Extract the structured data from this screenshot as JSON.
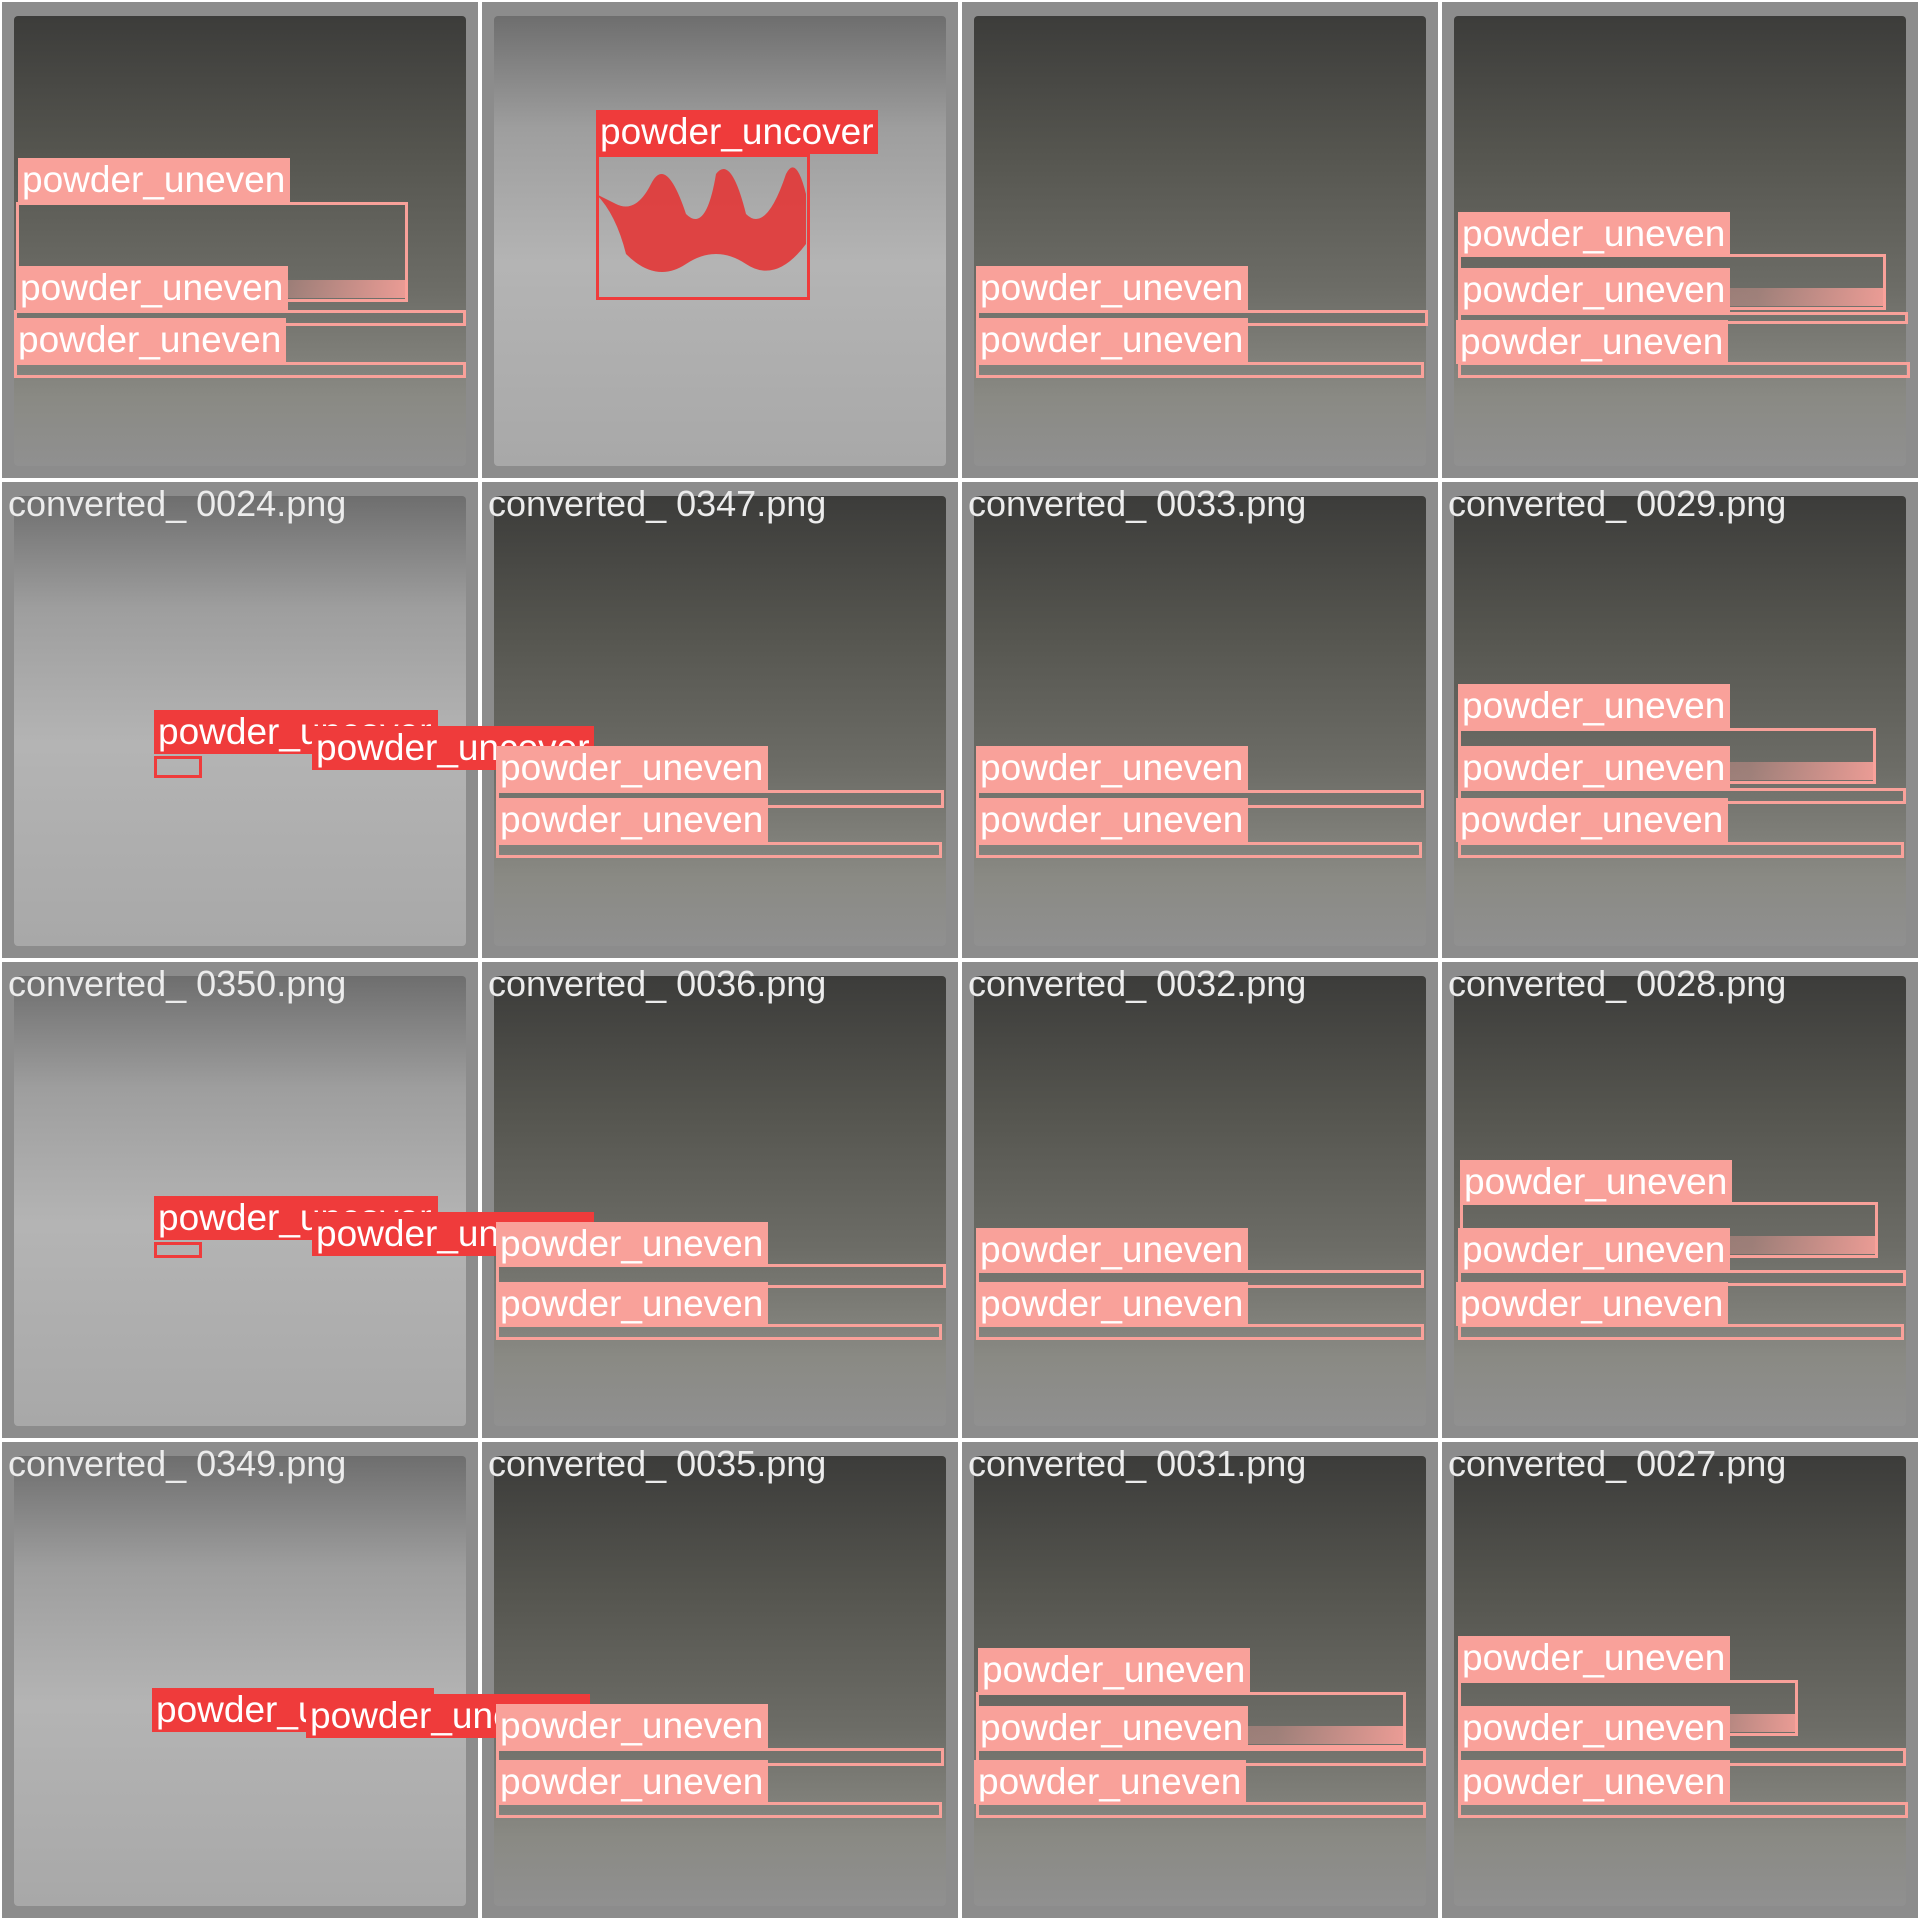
{
  "colors": {
    "uneven": "#f9a19a",
    "uncover": "#ef3b3b",
    "tile_border": "#8a8a8a"
  },
  "tiles": [
    {
      "filename": "",
      "surface": "dark",
      "detections": [
        {
          "cls": "powder_uneven",
          "label": "powder_uneven"
        },
        {
          "cls": "powder_uneven",
          "label": "powder_uneven"
        },
        {
          "cls": "powder_uneven",
          "label": "powder_uneven"
        }
      ]
    },
    {
      "filename": "",
      "surface": "light",
      "detections": [
        {
          "cls": "powder_uncover",
          "label": "powder_uncover"
        }
      ]
    },
    {
      "filename": "",
      "surface": "dark",
      "detections": [
        {
          "cls": "powder_uneven",
          "label": "powder_uneven"
        },
        {
          "cls": "powder_uneven",
          "label": "powder_uneven"
        }
      ]
    },
    {
      "filename": "",
      "surface": "dark",
      "detections": [
        {
          "cls": "powder_uneven",
          "label": "powder_uneven"
        },
        {
          "cls": "powder_uneven",
          "label": "powder_uneven"
        },
        {
          "cls": "powder_uneven",
          "label": "powder_uneven"
        }
      ]
    },
    {
      "filename": "converted_ 0024.png",
      "surface": "light",
      "detections": [
        {
          "cls": "powder_uncover",
          "label": "powder_uncover"
        },
        {
          "cls": "powder_uncover",
          "label": "powder_uncover"
        }
      ]
    },
    {
      "filename": "converted_ 0347.png",
      "surface": "dark",
      "detections": [
        {
          "cls": "powder_uneven",
          "label": "powder_uneven"
        },
        {
          "cls": "powder_uneven",
          "label": "powder_uneven"
        }
      ]
    },
    {
      "filename": "converted_ 0033.png",
      "surface": "dark",
      "detections": [
        {
          "cls": "powder_uneven",
          "label": "powder_uneven"
        },
        {
          "cls": "powder_uneven",
          "label": "powder_uneven"
        }
      ]
    },
    {
      "filename": "converted_ 0029.png",
      "surface": "dark",
      "detections": [
        {
          "cls": "powder_uneven",
          "label": "powder_uneven"
        },
        {
          "cls": "powder_uneven",
          "label": "powder_uneven"
        },
        {
          "cls": "powder_uneven",
          "label": "powder_uneven"
        }
      ]
    },
    {
      "filename": "converted_ 0350.png",
      "surface": "light",
      "detections": [
        {
          "cls": "powder_uncover",
          "label": "powder_uncover"
        },
        {
          "cls": "powder_uncover",
          "label": "powder_uncover"
        }
      ]
    },
    {
      "filename": "converted_ 0036.png",
      "surface": "dark",
      "detections": [
        {
          "cls": "powder_uneven",
          "label": "powder_uneven"
        },
        {
          "cls": "powder_uneven",
          "label": "powder_uneven"
        }
      ]
    },
    {
      "filename": "converted_ 0032.png",
      "surface": "dark",
      "detections": [
        {
          "cls": "powder_uneven",
          "label": "powder_uneven"
        },
        {
          "cls": "powder_uneven",
          "label": "powder_uneven"
        }
      ]
    },
    {
      "filename": "converted_ 0028.png",
      "surface": "dark",
      "detections": [
        {
          "cls": "powder_uneven",
          "label": "powder_uneven"
        },
        {
          "cls": "powder_uneven",
          "label": "powder_uneven"
        },
        {
          "cls": "powder_uneven",
          "label": "powder_uneven"
        }
      ]
    },
    {
      "filename": "converted_ 0349.png",
      "surface": "light",
      "detections": [
        {
          "cls": "powder_uncover",
          "label": "powder_uncover"
        },
        {
          "cls": "powder_uncover",
          "label": "powder_uncover"
        }
      ]
    },
    {
      "filename": "converted_ 0035.png",
      "surface": "dark",
      "detections": [
        {
          "cls": "powder_uneven",
          "label": "powder_uneven"
        },
        {
          "cls": "powder_uneven",
          "label": "powder_uneven"
        }
      ]
    },
    {
      "filename": "converted_ 0031.png",
      "surface": "dark",
      "detections": [
        {
          "cls": "powder_uneven",
          "label": "powder_uneven"
        },
        {
          "cls": "powder_uneven",
          "label": "powder_uneven"
        },
        {
          "cls": "powder_uneven",
          "label": "powder_uneven"
        }
      ]
    },
    {
      "filename": "converted_ 0027.png",
      "surface": "dark",
      "detections": [
        {
          "cls": "powder_uneven",
          "label": "powder_uneven"
        },
        {
          "cls": "powder_uneven",
          "label": "powder_uneven"
        },
        {
          "cls": "powder_uneven",
          "label": "powder_uneven"
        }
      ]
    }
  ]
}
